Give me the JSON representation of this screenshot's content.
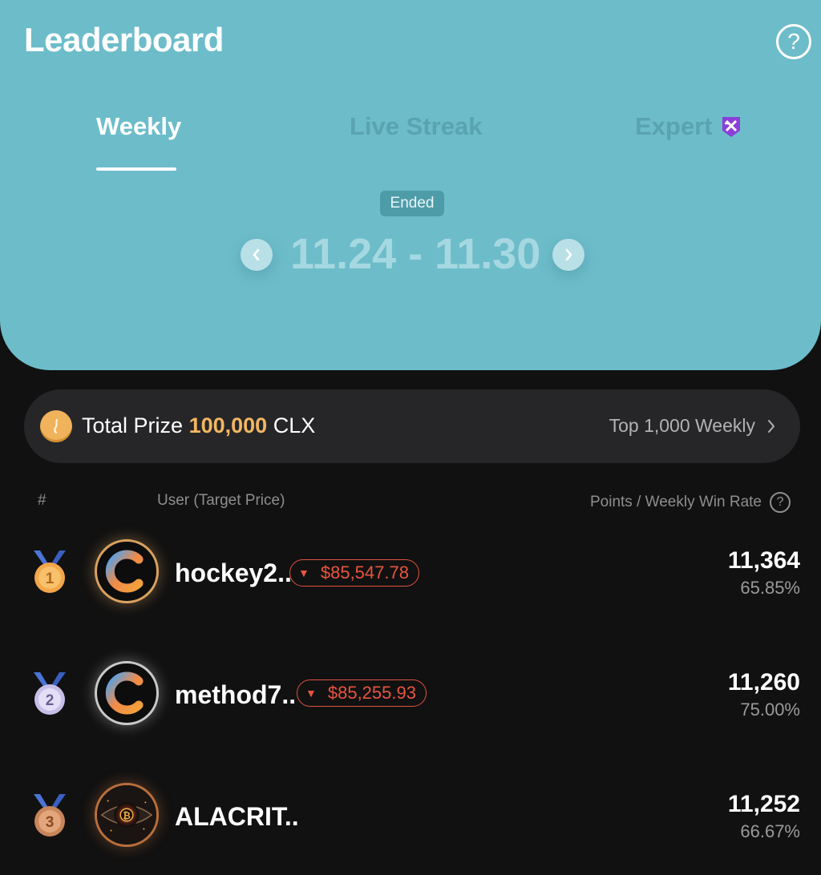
{
  "header": {
    "title": "Leaderboard",
    "help_icon": "question-circle-icon",
    "tabs": [
      {
        "label": "Weekly",
        "active": true
      },
      {
        "label": "Live Streak",
        "active": false
      },
      {
        "label": "Expert",
        "active": false,
        "badge_icon": "expert-shield-icon"
      }
    ],
    "status_pill": "Ended",
    "date_range": "11.24 - 11.30",
    "colors": {
      "header_bg": "#6dbcca",
      "active_tab": "#ffffff",
      "inactive_tab": "#5aa3b1"
    }
  },
  "prize": {
    "label": "Total Prize",
    "amount": "100,000",
    "currency": "CLX",
    "link_label": "Top 1,000 Weekly",
    "coin_icon": "coin-icon",
    "amount_color": "#f2b761"
  },
  "columns": {
    "rank": "#",
    "user": "User (Target Price)",
    "points": "Points / Weekly Win Rate"
  },
  "rows": [
    {
      "rank": "1",
      "medal": "gold-medal-icon",
      "username": "hockey2..",
      "target_price": "$85,547.78",
      "direction": "down",
      "points": "11,364",
      "win_rate": "65.85%",
      "avatar": "coinbase-logo-avatar"
    },
    {
      "rank": "2",
      "medal": "silver-medal-icon",
      "username": "method7..",
      "target_price": "$85,255.93",
      "direction": "down",
      "points": "11,260",
      "win_rate": "75.00%",
      "avatar": "coinbase-logo-avatar"
    },
    {
      "rank": "3",
      "medal": "bronze-medal-icon",
      "username": "ALACRIT..",
      "target_price": "",
      "points": "11,252",
      "win_rate": "66.67%",
      "avatar": "bitcoin-eye-avatar"
    }
  ]
}
